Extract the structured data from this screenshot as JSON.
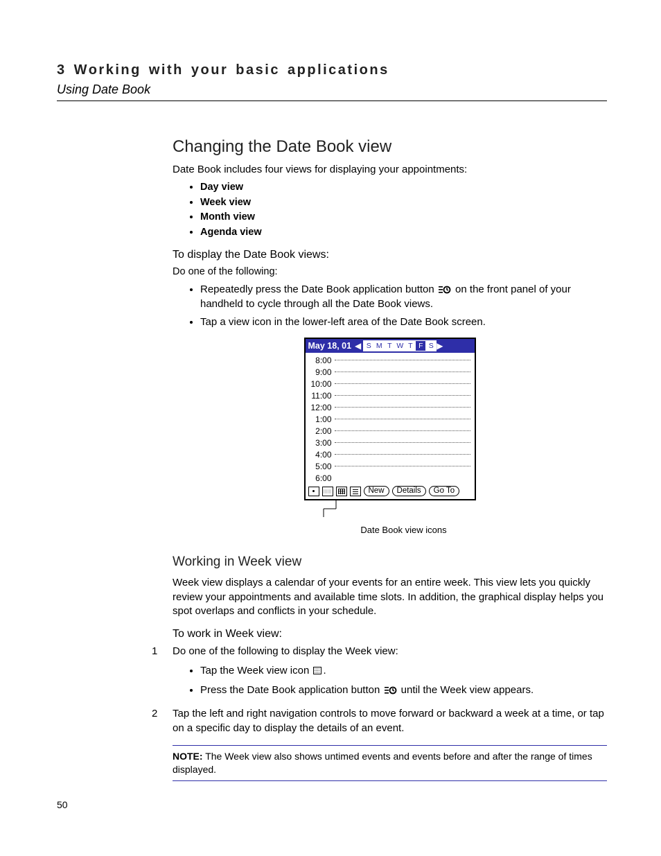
{
  "header": {
    "chapter": "3 Working with your basic applications",
    "section": "Using Date Book"
  },
  "h_changing": "Changing the Date Book view",
  "intro": "Date Book includes four views for displaying your appointments:",
  "view_list": [
    "Day view",
    "Week view",
    "Month view",
    "Agenda view"
  ],
  "to_display": "To display the Date Book views:",
  "do_one": "Do one of the following:",
  "step1a_pre": "Repeatedly press the Date Book application button ",
  "step1a_post": " on the front panel of your handheld to cycle through all the Date Book views.",
  "step1b": "Tap a view icon in the lower-left area of the Date Book screen.",
  "datebook": {
    "date": "May 18, 01",
    "days": [
      "S",
      "M",
      "T",
      "W",
      "T",
      "F",
      "S"
    ],
    "selected_index": 5,
    "hours": [
      "8:00",
      "9:00",
      "10:00",
      "11:00",
      "12:00",
      "1:00",
      "2:00",
      "3:00",
      "4:00",
      "5:00",
      "6:00"
    ],
    "buttons": {
      "new": "New",
      "details": "Details",
      "goto": "Go To"
    }
  },
  "caption": "Date Book view icons",
  "h_week": "Working in Week view",
  "week_intro": "Week view displays a calendar of your events for an entire week. This view lets you quickly review your appointments and available time slots. In addition, the graphical display helps you spot overlaps and conflicts in your schedule.",
  "to_work": "To work in Week view:",
  "ol1": "Do one of the following to display the Week view:",
  "ol1a_pre": "Tap the Week view icon ",
  "ol1a_post": ".",
  "ol1b_pre": "Press the Date Book application button ",
  "ol1b_post": " until the Week view appears.",
  "ol2": "Tap the left and right navigation controls to move forward or backward a week at a time, or tap on a specific day to display the details of an event.",
  "note_label": "NOTE:",
  "note_text": " The Week view also shows untimed events and events before and after the range of times displayed.",
  "page_num": "50"
}
